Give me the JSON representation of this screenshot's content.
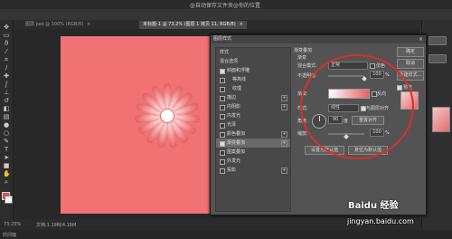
{
  "window": {
    "title": "@自动保存文件夹@你的位置"
  },
  "tabs": [
    {
      "label": "图层.psd @ 100% (RGB/8)",
      "active": false
    },
    {
      "label": "未标题-1 @ 73.2% (图层 1 拷贝 11, RGB/8)",
      "active": true
    }
  ],
  "toolbar": {
    "tools": [
      "move",
      "marquee",
      "lasso",
      "wand",
      "crop",
      "eyedropper",
      "heal",
      "brush",
      "stamp",
      "history",
      "eraser",
      "gradient",
      "blur",
      "dodge",
      "pen",
      "type",
      "path",
      "shape",
      "hand",
      "zoom"
    ]
  },
  "colors": {
    "foreground": "#e74c4c",
    "background": "#ffffff",
    "canvas": "#f07272",
    "annotation": "#d6302a"
  },
  "dialog": {
    "title": "图层样式",
    "close": "×",
    "list": [
      {
        "label": "样式",
        "head": true
      },
      {
        "label": "混合选项",
        "head": true
      },
      {
        "label": "斜面和浮雕",
        "checked": true
      },
      {
        "label": "等高线",
        "checked": false
      },
      {
        "label": "纹理",
        "checked": false
      },
      {
        "label": "描边",
        "checked": false,
        "plus": true
      },
      {
        "label": "内阴影",
        "checked": false,
        "plus": true
      },
      {
        "label": "内发光",
        "checked": false
      },
      {
        "label": "光泽",
        "checked": false
      },
      {
        "label": "颜色叠加",
        "checked": false,
        "plus": true
      },
      {
        "label": "渐变叠加",
        "checked": true,
        "plus": true,
        "selected": true
      },
      {
        "label": "图案叠加",
        "checked": false
      },
      {
        "label": "外发光",
        "checked": false
      },
      {
        "label": "投影",
        "checked": false,
        "plus": true
      }
    ],
    "panel": {
      "section": "渐变叠加",
      "sub": "渐变",
      "blend_label": "混合模式:",
      "blend_value": "正常",
      "dither_label": "仿色",
      "opacity_label": "不透明度:",
      "opacity_value": "100",
      "pct": "%",
      "gradient_label": "渐变:",
      "reverse_label": "反向",
      "style_label": "样式:",
      "style_value": "线性",
      "align_label": "与图层对齐",
      "angle_label": "角度:",
      "angle_value": "90",
      "deg": "度",
      "reset_align": "重置对齐",
      "scale_label": "缩放:",
      "scale_value": "100",
      "set_default": "设置为默认值",
      "reset_default": "复位为默认值"
    },
    "buttons": {
      "ok": "确定",
      "cancel": "取消",
      "new_style": "新建样式...",
      "preview": "预览"
    }
  },
  "status": {
    "zoom": "73.23%",
    "doc": "文档:1.19M/4.16M"
  },
  "bottom": {
    "label": "时间轴"
  },
  "watermark": {
    "brand": "Baidu 经验",
    "url": "jingyan.baidu.com"
  }
}
